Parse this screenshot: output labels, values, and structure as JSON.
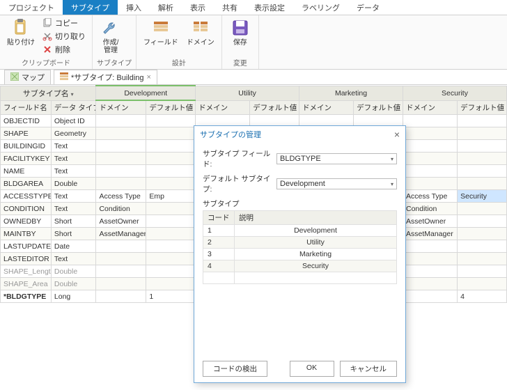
{
  "ribbon_tabs": [
    "プロジェクト",
    "サブタイプ",
    "挿入",
    "解析",
    "表示",
    "共有",
    "表示設定",
    "ラベリング",
    "データ"
  ],
  "active_ribbon_tab": 1,
  "ribbon": {
    "clipboard": {
      "paste": "貼り付け",
      "copy": "コピー",
      "cut": "切り取り",
      "delete": "削除",
      "group": "クリップボード"
    },
    "subtype": {
      "create_manage": "作成/\n管理",
      "group": "サブタイプ"
    },
    "design": {
      "field": "フィールド",
      "domain": "ドメイン",
      "group": "設計"
    },
    "changes": {
      "save": "保存",
      "group": "変更"
    }
  },
  "doc_tabs": {
    "map": "マップ",
    "subtype_building": "*サブタイプ: Building"
  },
  "grid": {
    "header1": {
      "subtype_name": "サブタイプ名",
      "cols": [
        "Development",
        "Utility",
        "Marketing",
        "Security"
      ]
    },
    "header2": {
      "field_name": "フィールド名",
      "data_type": "データ タイプ",
      "domain": "ドメイン",
      "default": "デフォルト値"
    },
    "rows": [
      {
        "f": "OBJECTID",
        "t": "Object ID",
        "alt": false
      },
      {
        "f": "SHAPE",
        "t": "Geometry",
        "alt": true
      },
      {
        "f": "BUILDINGID",
        "t": "Text",
        "alt": false
      },
      {
        "f": "FACILITYKEY",
        "t": "Text",
        "alt": true
      },
      {
        "f": "NAME",
        "t": "Text",
        "alt": false
      },
      {
        "f": "BLDGAREA",
        "t": "Double",
        "alt": true
      },
      {
        "f": "ACCESSTYPE",
        "t": "Text",
        "alt": false,
        "dom": "Access Type",
        "def": "Emp",
        "dom4": "Access Type",
        "def4": "Security",
        "hl4": true
      },
      {
        "f": "CONDITION",
        "t": "Text",
        "alt": true,
        "dom": "Condition",
        "dom4": "Condition"
      },
      {
        "f": "OWNEDBY",
        "t": "Short",
        "alt": false,
        "dom": "AssetOwner",
        "dom4": "AssetOwner"
      },
      {
        "f": "MAINTBY",
        "t": "Short",
        "alt": true,
        "dom": "AssetManager",
        "dom4": "AssetManager"
      },
      {
        "f": "LASTUPDATE",
        "t": "Date",
        "alt": false
      },
      {
        "f": "LASTEDITOR",
        "t": "Text",
        "alt": true
      },
      {
        "f": "SHAPE_Length",
        "t": "Double",
        "alt": false,
        "dim": true
      },
      {
        "f": "SHAPE_Area",
        "t": "Double",
        "alt": true,
        "dim": true
      },
      {
        "f": "*BLDGTYPE",
        "t": "Long",
        "alt": false,
        "bold": true,
        "def": "1",
        "def4": "4"
      }
    ]
  },
  "dialog": {
    "title": "サブタイプの管理",
    "field_label": "サブタイプ フィールド:",
    "field_value": "BLDGTYPE",
    "default_label": "デフォルト サブタイプ:",
    "default_value": "Development",
    "section": "サブタイプ",
    "col_code": "コード",
    "col_desc": "説明",
    "rows": [
      {
        "code": "1",
        "desc": "Development"
      },
      {
        "code": "2",
        "desc": "Utility"
      },
      {
        "code": "3",
        "desc": "Marketing"
      },
      {
        "code": "4",
        "desc": "Security"
      }
    ],
    "detect": "コードの検出",
    "ok": "OK",
    "cancel": "キャンセル"
  }
}
